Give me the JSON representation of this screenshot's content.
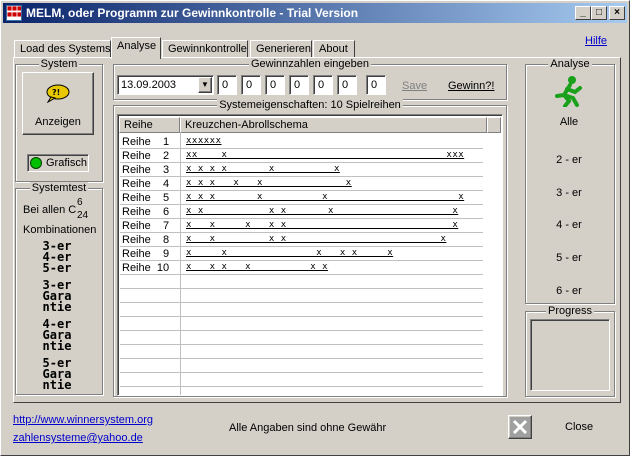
{
  "window": {
    "title": "MELM, oder Programm zur Gewinnkontrolle - Trial Version",
    "min": "_",
    "max": "□",
    "close": "×"
  },
  "tabs": [
    "Load des Systems",
    "Analyse",
    "Gewinnkontrolle",
    "Generieren",
    "About"
  ],
  "help": "Hilfe",
  "system": {
    "title": "System",
    "anzeigen": "Anzeigen",
    "grafisch": "Grafisch"
  },
  "systemtest": {
    "title": "Systemtest",
    "bei_allen": "Bei allen C",
    "c_top": "6",
    "c_bot": "24",
    "kombinationen": "Kombinationen",
    "l1": "3-er",
    "l2": "4-er",
    "l3": "5-er",
    "g3a": "3-er",
    "g3b": "Gara",
    "g3c": "ntie",
    "g4a": "4-er",
    "g4b": "Gara",
    "g4c": "ntie",
    "g5a": "5-er",
    "g5b": "Gara",
    "g5c": "ntie"
  },
  "gewinnzahlen": {
    "title": "Gewinnzahlen eingeben",
    "date": "13.09.2003",
    "numbers": [
      "0",
      "0",
      "0",
      "0",
      "0",
      "0",
      "0"
    ],
    "save": "Save",
    "gewinn": "Gewinn?!"
  },
  "systemeigenschaften": {
    "title": "Systemeigenschaften: 10 Spielreihen",
    "col1": "Reihe",
    "col2": "Kreuzchen-Abrollschema",
    "rows": [
      {
        "label": "Reihe    1",
        "value": "xxxxxx"
      },
      {
        "label": "Reihe    2",
        "value": "xx    x                                     xxx"
      },
      {
        "label": "Reihe    3",
        "value": "x x x x       x          x"
      },
      {
        "label": "Reihe    4",
        "value": "x x x   x   x              x"
      },
      {
        "label": "Reihe    5",
        "value": "x x x       x          x                      x"
      },
      {
        "label": "Reihe    6",
        "value": "x x           x x       x                    x"
      },
      {
        "label": "Reihe    7",
        "value": "x   x     x   x x                            x"
      },
      {
        "label": "Reihe    8",
        "value": "x   x         x x                          x"
      },
      {
        "label": "Reihe    9",
        "value": "x     x               x   x x     x"
      },
      {
        "label": "Reihe  10",
        "value": "x   x x   x          x x"
      }
    ]
  },
  "analyse": {
    "title": "Analyse",
    "alle": "Alle",
    "items": [
      "2 - er",
      "3 - er",
      "4 - er",
      "5 - er",
      "6 - er"
    ],
    "progress": "Progress"
  },
  "footer": {
    "link1": "http://www.winnersystem.org",
    "link2": "zahlensysteme@yahoo.de",
    "note": "Alle Angaben sind ohne Gewähr",
    "close": "Close"
  }
}
